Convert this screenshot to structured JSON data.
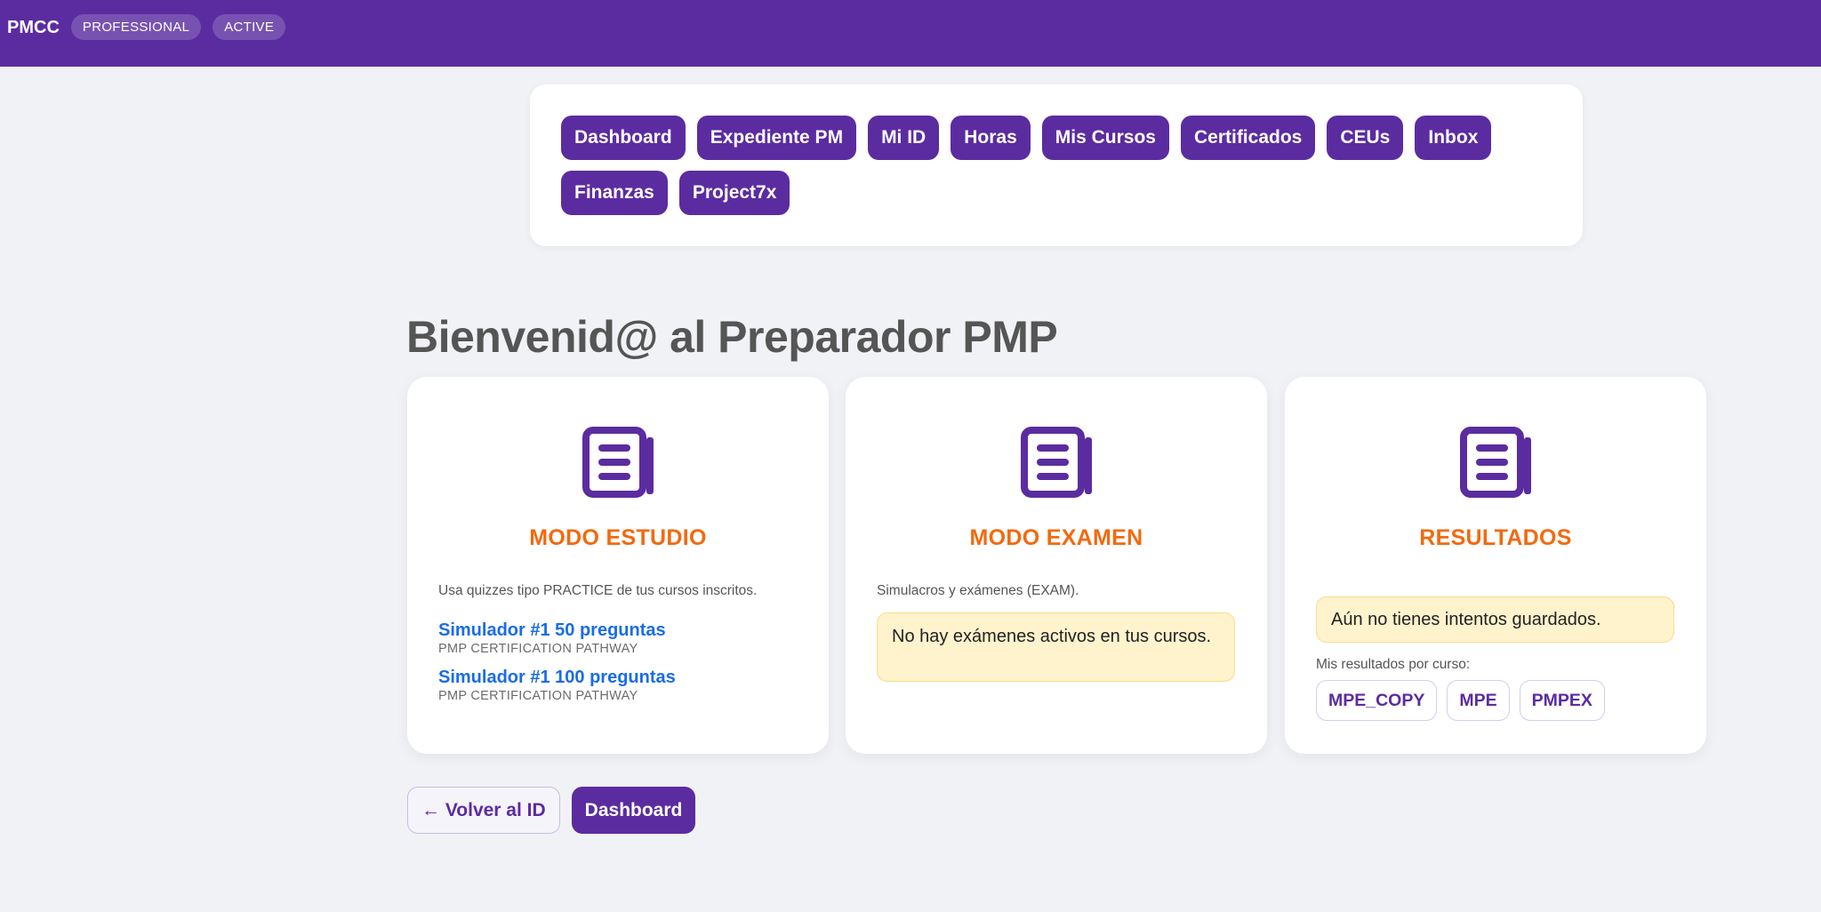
{
  "header": {
    "brand": "PMCC",
    "badges": [
      "PROFESSIONAL",
      "ACTIVE"
    ],
    "background_color": "#5b2ca0"
  },
  "nav": {
    "items": [
      "Dashboard",
      "Expediente PM",
      "Mi ID",
      "Horas",
      "Mis Cursos",
      "Certificados",
      "CEUs",
      "Inbox",
      "Finanzas",
      "Project7x"
    ]
  },
  "main": {
    "title": "Bienvenid@ al Preparador PMP"
  },
  "cards": {
    "study": {
      "icon": "document-icon",
      "title": "MODO ESTUDIO",
      "description": "Usa quizzes tipo PRACTICE de tus cursos inscritos.",
      "quizzes": [
        {
          "title": "Simulador #1 50 preguntas",
          "course": "PMP CERTIFICATION PATHWAY"
        },
        {
          "title": "Simulador #1 100 preguntas",
          "course": "PMP CERTIFICATION PATHWAY"
        }
      ]
    },
    "exam": {
      "icon": "document-icon",
      "title": "MODO EXAMEN",
      "description": "Simulacros y exámenes (EXAM).",
      "notice": "No hay exámenes activos en tus cursos."
    },
    "results": {
      "icon": "document-icon",
      "title": "RESULTADOS",
      "notice": "Aún no tienes intentos guardados.",
      "per_course_label": "Mis resultados por curso:",
      "courses": [
        "MPE_COPY",
        "MPE",
        "PMPEX"
      ]
    }
  },
  "actions": {
    "back_label": "← Volver al ID",
    "dashboard_label": "Dashboard"
  },
  "colors": {
    "accent": "#5b2ca0",
    "title_orange": "#f26a0f",
    "link_blue": "#1a6ce8",
    "notice_bg": "#fff3cd"
  }
}
